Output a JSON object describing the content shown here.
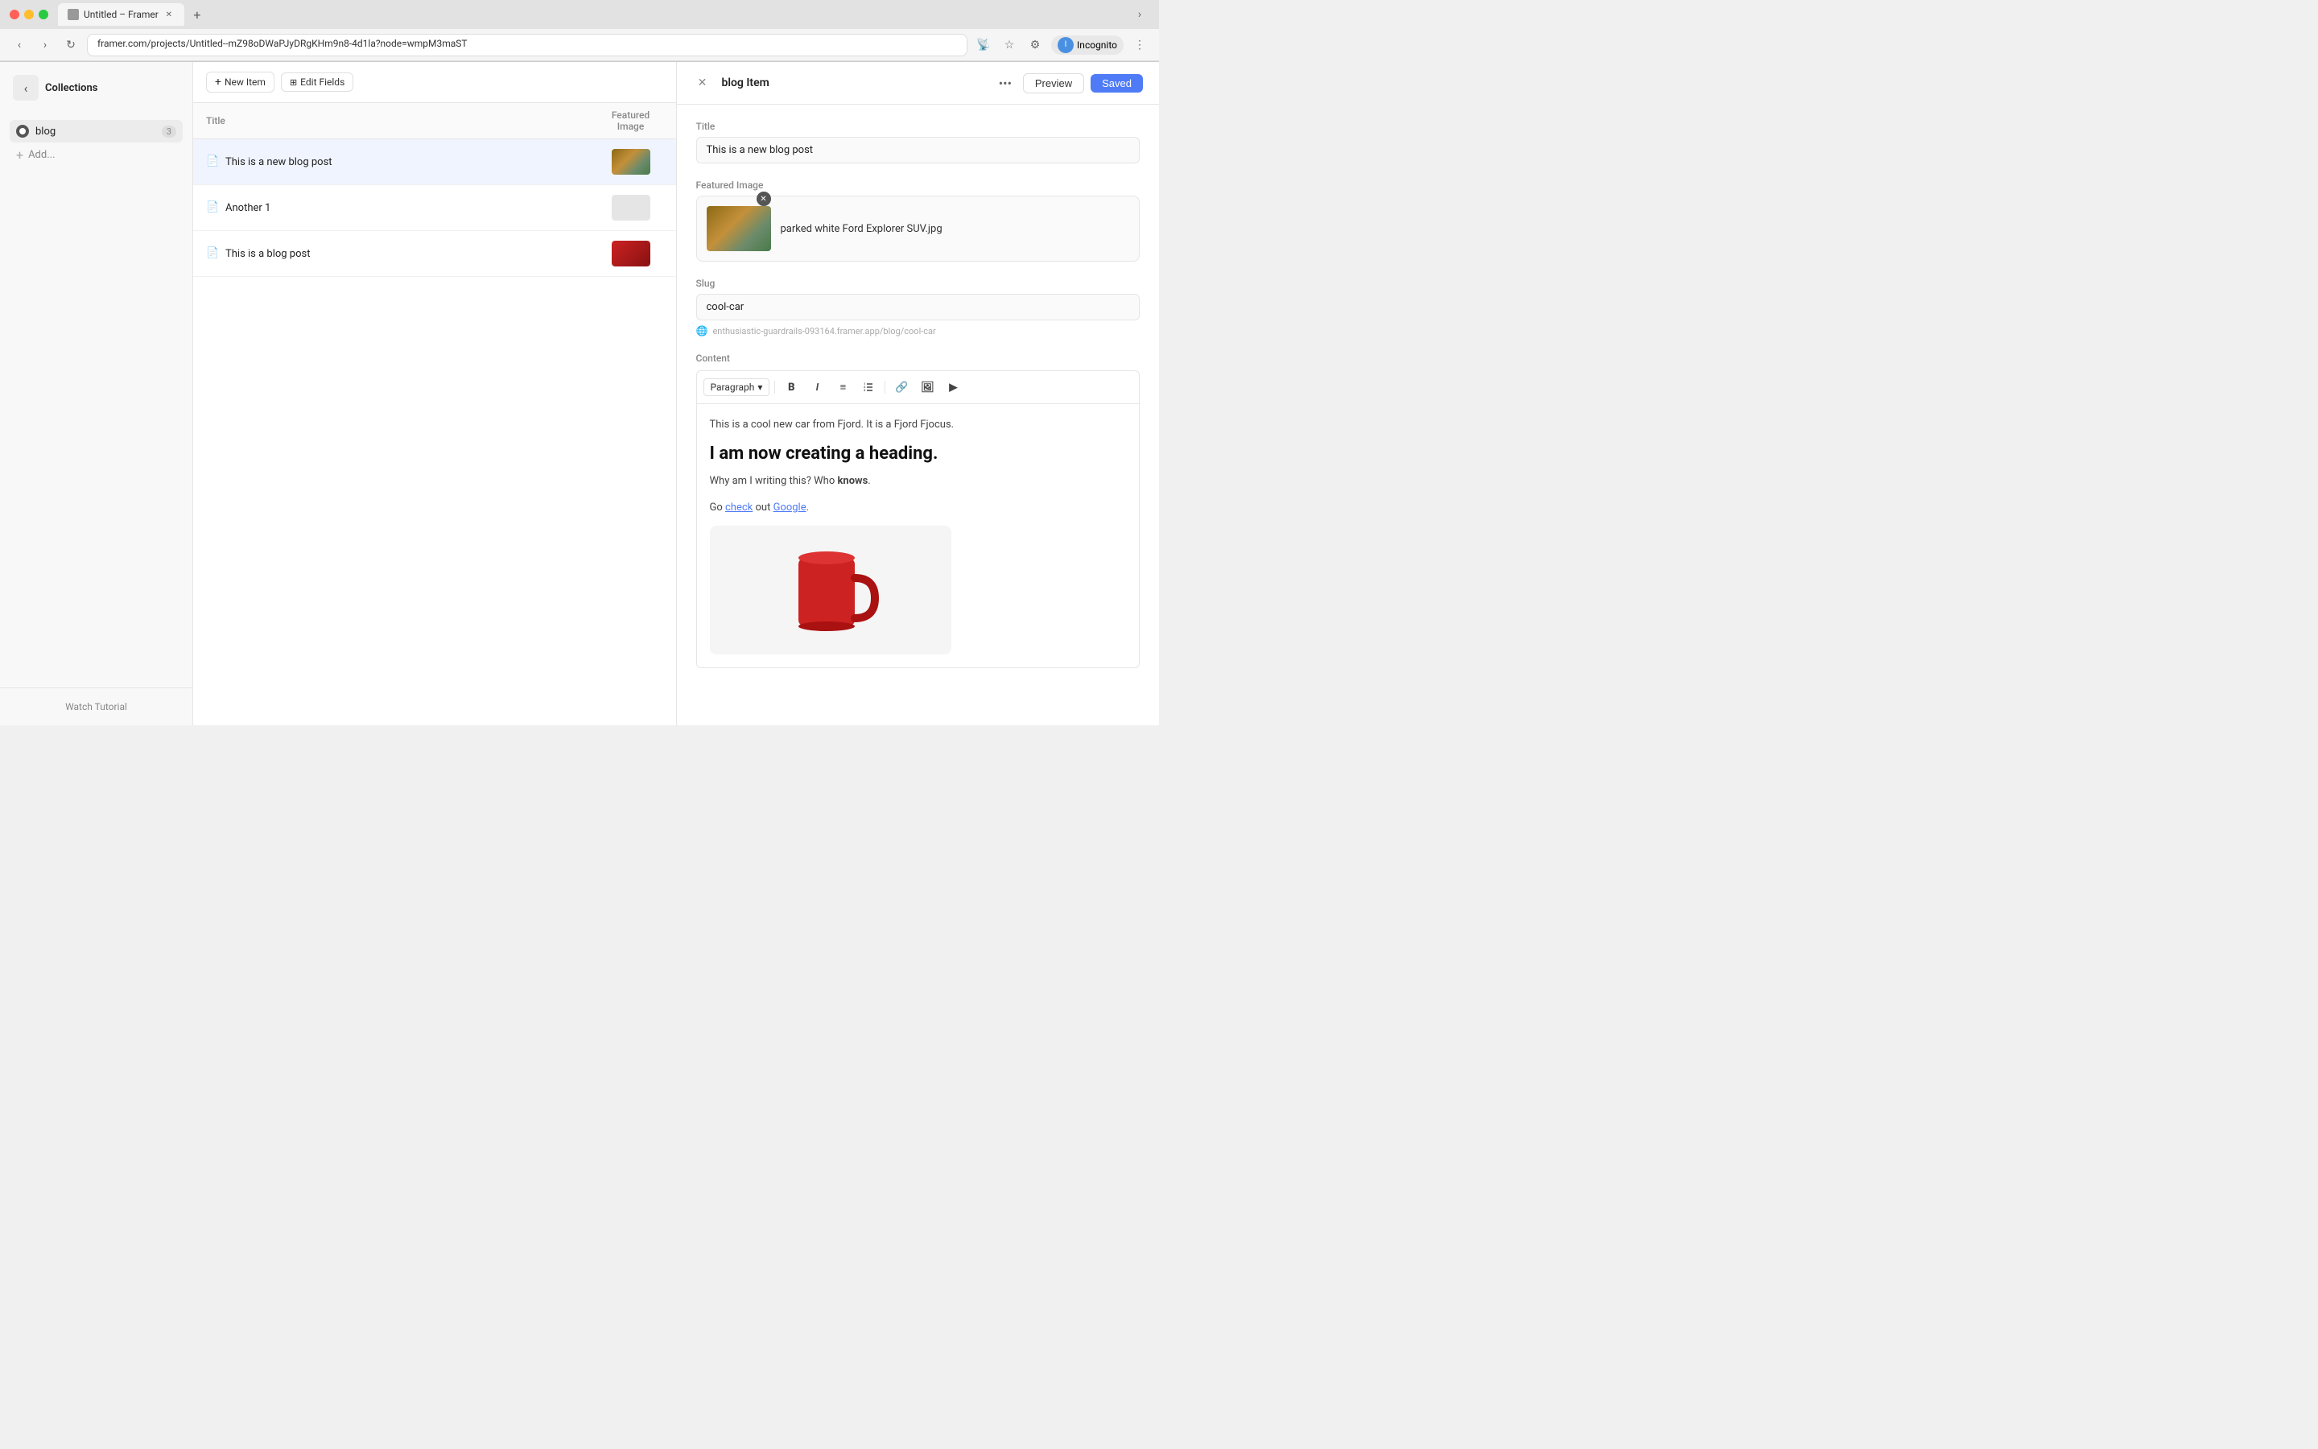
{
  "browser": {
    "tab_title": "Untitled – Framer",
    "url": "framer.com/projects/Untitled--mZ98oDWaPJyDRgKHm9n8-4d1la?node=wmpM3maST",
    "profile_label": "Incognito"
  },
  "sidebar": {
    "collections_label": "Collections",
    "collection_name": "blog",
    "collection_count": "3",
    "add_label": "Add...",
    "watch_tutorial": "Watch Tutorial"
  },
  "collection_toolbar": {
    "new_item_label": "New Item",
    "edit_fields_label": "Edit Fields"
  },
  "table": {
    "col_title": "Title",
    "col_image": "Featured Image",
    "rows": [
      {
        "title": "This is a new blog post",
        "has_image": true
      },
      {
        "title": "Another 1",
        "has_image": false
      },
      {
        "title": "This is a blog post",
        "has_image": true,
        "mug": true
      }
    ]
  },
  "detail": {
    "panel_title": "blog Item",
    "preview_label": "Preview",
    "saved_label": "Saved",
    "fields": {
      "title_label": "Title",
      "title_value": "This is a new blog post",
      "featured_image_label": "Featured Image",
      "image_filename": "parked white Ford Explorer SUV.jpg",
      "slug_label": "Slug",
      "slug_value": "cool-car",
      "slug_hint": "enthusiastic-guardrails-093164.framer.app/blog/cool-car",
      "content_label": "Content"
    },
    "editor": {
      "format_label": "Paragraph",
      "body": {
        "para1": "This is a cool new car from Fjord. It is a Fjord Fjocus.",
        "heading": "I am now creating a heading.",
        "para2_prefix": "Why am I writing this? Who ",
        "para2_bold": "knows",
        "para2_suffix": ".",
        "para3_prefix": "Go ",
        "para3_link1": "check",
        "para3_mid": " out ",
        "para3_link2": "Google",
        "para3_suffix": "."
      }
    }
  }
}
